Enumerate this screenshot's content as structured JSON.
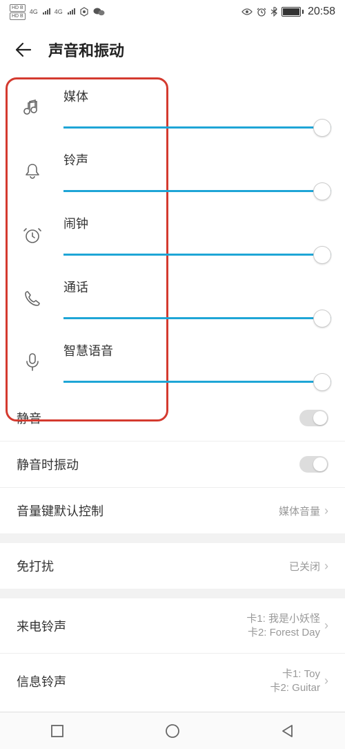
{
  "status": {
    "hd1": "HD B",
    "hd2": "HD B",
    "sig1": "4G",
    "sig2": "4G",
    "time": "20:58"
  },
  "header": {
    "title": "声音和振动"
  },
  "sliders": [
    {
      "label": "媒体",
      "icon": "music",
      "pct": 100
    },
    {
      "label": "铃声",
      "icon": "bell",
      "pct": 100
    },
    {
      "label": "闹钟",
      "icon": "alarm",
      "pct": 100
    },
    {
      "label": "通话",
      "icon": "phone",
      "pct": 100
    },
    {
      "label": "智慧语音",
      "icon": "mic",
      "pct": 100
    }
  ],
  "rows": {
    "mute": {
      "label": "静音"
    },
    "vibrate": {
      "label": "静音时振动"
    },
    "volKey": {
      "label": "音量键默认控制",
      "value": "媒体音量"
    },
    "dnd": {
      "label": "免打扰",
      "value": "已关闭"
    },
    "ringtone": {
      "label": "来电铃声",
      "line1": "卡1: 我是小妖怪",
      "line2": "卡2: Forest Day"
    },
    "msgtone": {
      "label": "信息铃声",
      "line1": "卡1: Toy",
      "line2": "卡2: Guitar"
    }
  }
}
